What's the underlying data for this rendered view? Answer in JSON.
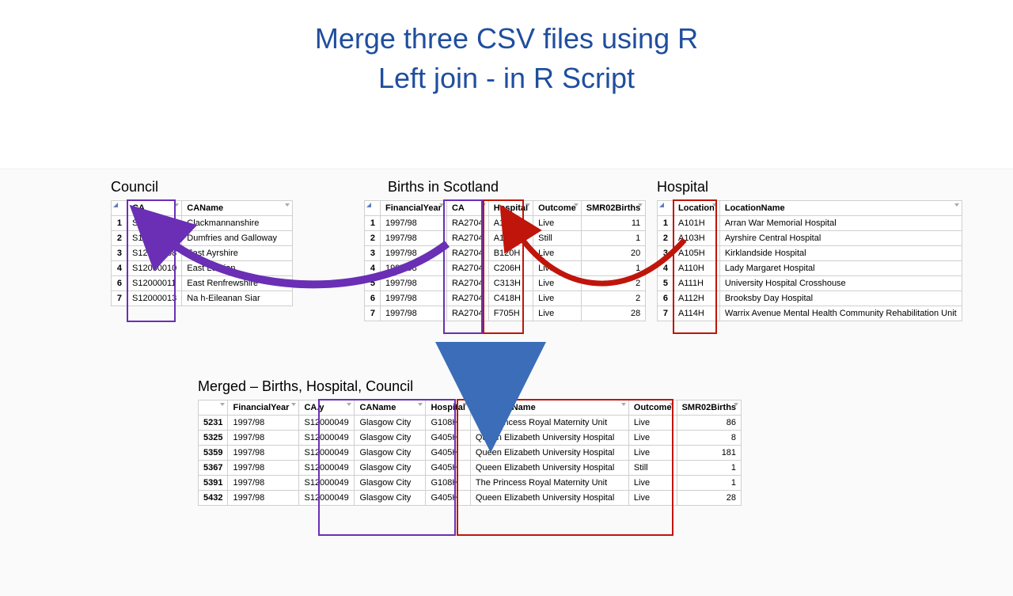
{
  "title1": "Merge three CSV files using R",
  "title2": "Left join - in R Script",
  "council": {
    "label": "Council",
    "headers": [
      "CA",
      "CAName"
    ],
    "rows": [
      [
        "1",
        "S12000005",
        "Clackmannanshire"
      ],
      [
        "2",
        "S12000006",
        "Dumfries and Galloway"
      ],
      [
        "3",
        "S12000008",
        "East Ayrshire"
      ],
      [
        "4",
        "S12000010",
        "East Lothian"
      ],
      [
        "6",
        "S12000011",
        "East Renfrewshire"
      ],
      [
        "7",
        "S12000013",
        "Na h-Eileanan Siar"
      ]
    ]
  },
  "births": {
    "label": "Births in Scotland",
    "headers": [
      "FinancialYear",
      "CA",
      "Hospital",
      "Outcome",
      "SMR02Births"
    ],
    "rows": [
      [
        "1",
        "1997/98",
        "RA2704",
        "A103H",
        "Live",
        "11"
      ],
      [
        "2",
        "1997/98",
        "RA2704",
        "A103H",
        "Still",
        "1"
      ],
      [
        "3",
        "1997/98",
        "RA2704",
        "B120H",
        "Live",
        "20"
      ],
      [
        "4",
        "1997/98",
        "RA2704",
        "C206H",
        "Live",
        "1"
      ],
      [
        "5",
        "1997/98",
        "RA2704",
        "C313H",
        "Live",
        "2"
      ],
      [
        "6",
        "1997/98",
        "RA2704",
        "C418H",
        "Live",
        "2"
      ],
      [
        "7",
        "1997/98",
        "RA2704",
        "F705H",
        "Live",
        "28"
      ]
    ]
  },
  "hospital": {
    "label": "Hospital",
    "headers": [
      "Location",
      "LocationName"
    ],
    "rows": [
      [
        "1",
        "A101H",
        "Arran War Memorial Hospital"
      ],
      [
        "2",
        "A103H",
        "Ayrshire Central Hospital"
      ],
      [
        "3",
        "A105H",
        "Kirklandside Hospital"
      ],
      [
        "4",
        "A110H",
        "Lady Margaret Hospital"
      ],
      [
        "5",
        "A111H",
        "University Hospital Crosshouse"
      ],
      [
        "6",
        "A112H",
        "Brooksby Day Hospital"
      ],
      [
        "7",
        "A114H",
        "Warrix Avenue Mental Health Community Rehabilitation Unit"
      ]
    ]
  },
  "merged": {
    "label": "Merged – Births, Hospital, Council",
    "headers": [
      "FinancialYear",
      "CA.y",
      "CAName",
      "Hospital",
      "LocationName",
      "Outcome",
      "SMR02Births"
    ],
    "rows": [
      [
        "5231",
        "1997/98",
        "S12000049",
        "Glasgow City",
        "G108H",
        "The Princess Royal Maternity Unit",
        "Live",
        "86"
      ],
      [
        "5325",
        "1997/98",
        "S12000049",
        "Glasgow City",
        "G405H",
        "Queen Elizabeth University Hospital",
        "Live",
        "8"
      ],
      [
        "5359",
        "1997/98",
        "S12000049",
        "Glasgow City",
        "G405H",
        "Queen Elizabeth University Hospital",
        "Live",
        "181"
      ],
      [
        "5367",
        "1997/98",
        "S12000049",
        "Glasgow City",
        "G405H",
        "Queen Elizabeth University Hospital",
        "Still",
        "1"
      ],
      [
        "5391",
        "1997/98",
        "S12000049",
        "Glasgow City",
        "G108H",
        "The Princess Royal Maternity Unit",
        "Live",
        "1"
      ],
      [
        "5432",
        "1997/98",
        "S12000049",
        "Glasgow City",
        "G405H",
        "Queen Elizabeth University Hospital",
        "Live",
        "28"
      ]
    ]
  }
}
